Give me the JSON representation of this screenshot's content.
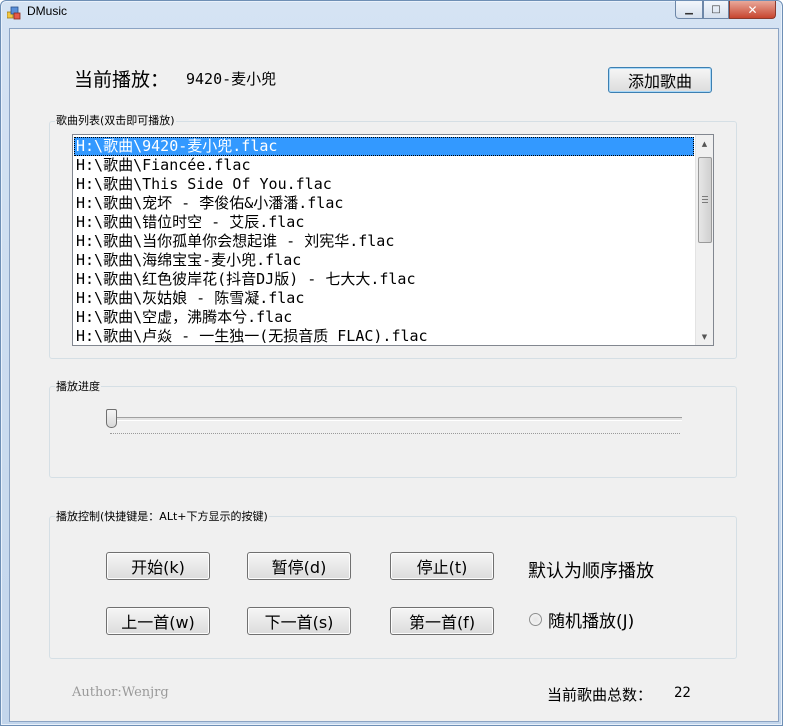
{
  "window": {
    "title": "DMusic",
    "minimize_glyph": "▁",
    "maximize_glyph": "□",
    "close_glyph": "✕"
  },
  "now_playing": {
    "label": "当前播放：",
    "value": "9420-麦小兜"
  },
  "add_button_label": "添加歌曲",
  "playlist": {
    "title": "歌曲列表(双击即可播放)",
    "selected_index": 0,
    "items": [
      "H:\\歌曲\\9420-麦小兜.flac",
      "H:\\歌曲\\Fiancée.flac",
      "H:\\歌曲\\This Side Of You.flac",
      "H:\\歌曲\\宠坏 - 李俊佑&小潘潘.flac",
      "H:\\歌曲\\错位时空 - 艾辰.flac",
      "H:\\歌曲\\当你孤单你会想起谁 - 刘宪华.flac",
      "H:\\歌曲\\海绵宝宝-麦小兜.flac",
      "H:\\歌曲\\红色彼岸花(抖音DJ版) - 七大大.flac",
      "H:\\歌曲\\灰姑娘 - 陈雪凝.flac",
      "H:\\歌曲\\空虚，沸腾本兮.flac",
      "H:\\歌曲\\卢焱 - 一生独一(无损音质 FLAC).flac"
    ],
    "scroll_up_glyph": "▲",
    "scroll_down_glyph": "▼"
  },
  "progress": {
    "title": "播放进度",
    "value": 0
  },
  "controls": {
    "title": "播放控制(快捷键是：ALt+下方显示的按键)",
    "start": "开始(k)",
    "pause": "暂停(d)",
    "stop": "停止(t)",
    "prev": "上一首(w)",
    "next": "下一首(s)",
    "first": "第一首(f)",
    "mode_text": "默认为顺序播放",
    "random_label": "随机播放(J)",
    "random_checked": false
  },
  "footer": {
    "author": "Author:Wenjrg",
    "total_label": "当前歌曲总数：",
    "total_value": "22"
  },
  "colors": {
    "selection": "#3399ff",
    "window_border": "#6e8fb5",
    "client_bg": "#f0f0f0",
    "close_button": "#c7452f"
  }
}
